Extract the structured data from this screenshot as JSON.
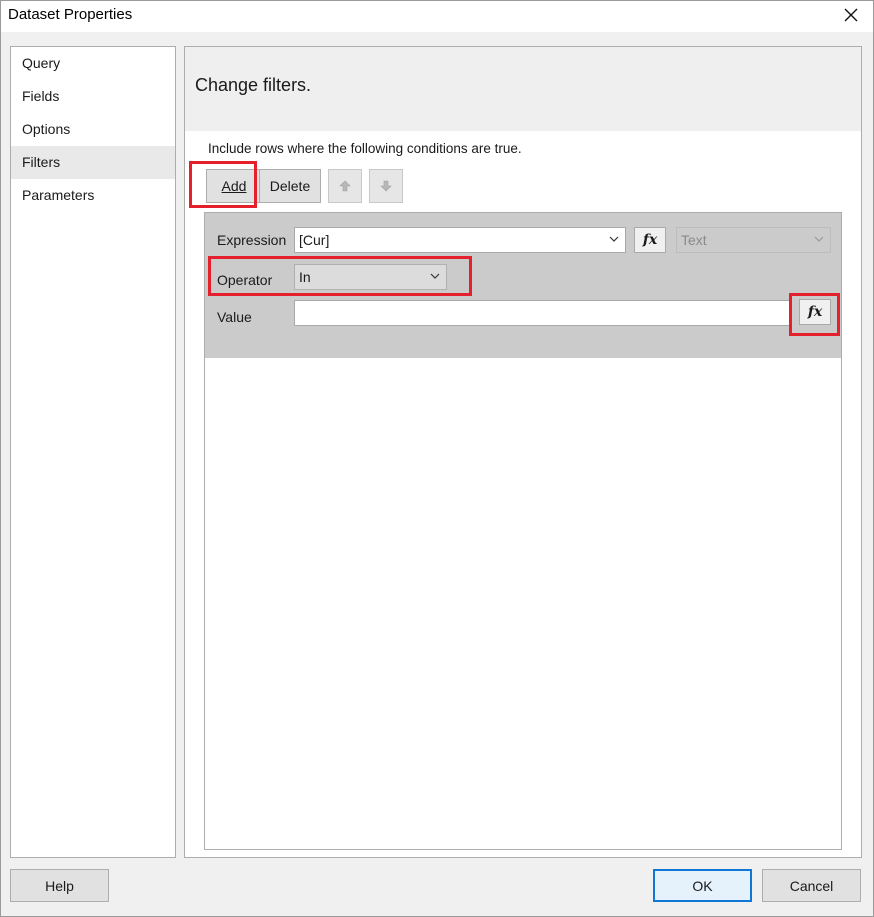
{
  "window": {
    "title": "Dataset Properties",
    "close_glyph": "✕"
  },
  "nav": {
    "items": [
      {
        "label": "Query"
      },
      {
        "label": "Fields"
      },
      {
        "label": "Options"
      },
      {
        "label": "Filters",
        "active": true
      },
      {
        "label": "Parameters"
      }
    ]
  },
  "main": {
    "heading": "Change filters.",
    "instruction": "Include rows where the following conditions are true.",
    "toolbar": {
      "add_label": "Add",
      "delete_label": "Delete",
      "move_up_icon": "arrow-up-icon",
      "move_down_icon": "arrow-down-icon"
    },
    "filter": {
      "expression_label": "Expression",
      "expression_value": "[Cur]",
      "type_value": "Text",
      "operator_label": "Operator",
      "operator_value": "In",
      "value_label": "Value",
      "value_value": "",
      "fx_label": "fx"
    }
  },
  "footer": {
    "help_label": "Help",
    "ok_label": "OK",
    "cancel_label": "Cancel"
  },
  "colors": {
    "highlight": "#e4202c",
    "primary_border": "#0f78d7"
  }
}
